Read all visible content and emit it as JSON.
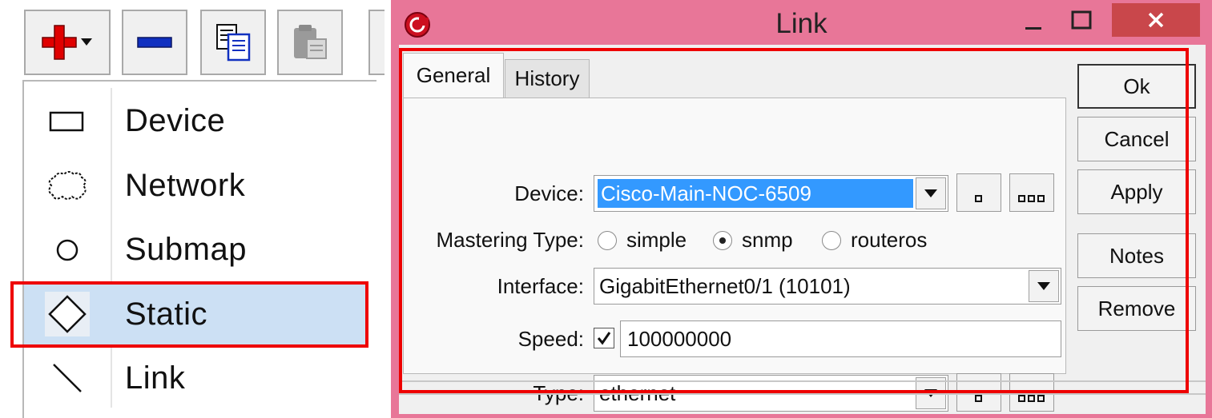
{
  "toolbar": {
    "buttons": [
      {
        "name": "add",
        "icon": "plus-dropdown-icon"
      },
      {
        "name": "remove",
        "icon": "minus-icon"
      },
      {
        "name": "copy",
        "icon": "copy-icon"
      },
      {
        "name": "paste",
        "icon": "paste-icon",
        "disabled": true
      }
    ]
  },
  "menu": {
    "items": [
      {
        "label": "Device",
        "icon": "rectangle-icon"
      },
      {
        "label": "Network",
        "icon": "cloud-icon"
      },
      {
        "label": "Submap",
        "icon": "circle-icon"
      },
      {
        "label": "Static",
        "icon": "diamond-icon",
        "selected": true
      },
      {
        "label": "Link",
        "icon": "line-icon"
      }
    ]
  },
  "dialog": {
    "title": "Link",
    "tabs": [
      {
        "label": "General",
        "active": true
      },
      {
        "label": "History",
        "active": false
      }
    ],
    "fields": {
      "device": {
        "label": "Device:",
        "value": "Cisco-Main-NOC-6509"
      },
      "mastering_type": {
        "label": "Mastering Type:",
        "options": [
          "simple",
          "snmp",
          "routeros"
        ],
        "selected": "snmp"
      },
      "interface": {
        "label": "Interface:",
        "value": "GigabitEthernet0/1 (10101)"
      },
      "speed": {
        "label": "Speed:",
        "checked": true,
        "value": "100000000"
      },
      "type": {
        "label": "Type:",
        "value": "ethernet"
      }
    },
    "buttons": {
      "ok": "Ok",
      "cancel": "Cancel",
      "apply": "Apply",
      "notes": "Notes",
      "remove": "Remove"
    }
  },
  "colors": {
    "highlight_box": "#ee0000",
    "title_bar": "#e87698",
    "close_button": "#c9474b",
    "selection": "#3399ff",
    "selected_menu_item": "#cce0f4"
  }
}
